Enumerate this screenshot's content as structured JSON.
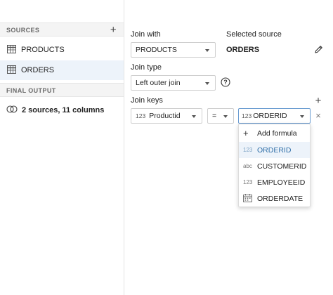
{
  "sidebar": {
    "sources_header": "SOURCES",
    "add_icon": "+",
    "sources": [
      {
        "label": "PRODUCTS",
        "icon": "table-icon"
      },
      {
        "label": "ORDERS",
        "icon": "table-icon"
      }
    ],
    "final_output_header": "FINAL OUTPUT",
    "output_summary": "2 sources, 11 columns",
    "output_icon": "join-circles-icon"
  },
  "join": {
    "join_with_label": "Join with",
    "join_with_value": "PRODUCTS",
    "selected_source_label": "Selected source",
    "selected_source_value": "ORDERS",
    "join_type_label": "Join type",
    "join_type_value": "Left outer join",
    "join_keys_label": "Join keys",
    "add_key_icon": "+",
    "left_key": {
      "type": "123",
      "value": "Productid"
    },
    "operator": "=",
    "right_key": {
      "type": "123",
      "value": "ORDERID"
    },
    "remove_icon": "×"
  },
  "dropdown": {
    "add_formula_icon": "+",
    "add_formula": "Add formula",
    "options": [
      {
        "type": "123",
        "label": "ORDERID",
        "highlighted": true
      },
      {
        "type": "abc",
        "label": "CUSTOMERID",
        "highlighted": false
      },
      {
        "type": "123",
        "label": "EMPLOYEEID",
        "highlighted": false
      },
      {
        "type": "calendar-icon",
        "label": "ORDERDATE",
        "highlighted": false
      }
    ]
  },
  "colors": {
    "accent": "#2f6fa8",
    "selected_bg": "#edf3fa",
    "header_bg": "#f4f4f4"
  }
}
